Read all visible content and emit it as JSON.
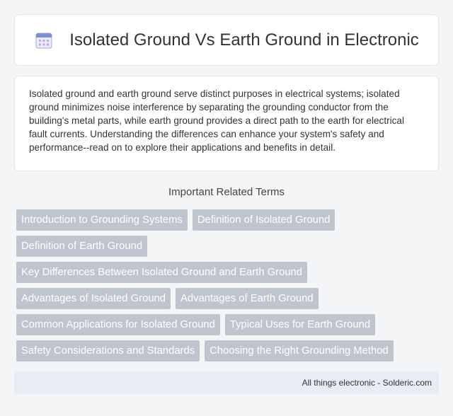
{
  "header": {
    "title": "Isolated Ground Vs Earth Ground in Electronic",
    "icon": "calendar-grid-icon"
  },
  "intro": {
    "text": "Isolated ground and earth ground serve distinct purposes in electrical systems; isolated ground minimizes noise interference by separating the grounding conductor from the building's metal parts, while earth ground provides a direct path to the earth for electrical fault currents. Understanding the differences can enhance your system's safety and performance--read on to explore their applications and benefits in detail."
  },
  "terms": {
    "heading": "Important Related Terms",
    "items": [
      "Introduction to Grounding Systems",
      "Definition of Isolated Ground",
      "Definition of Earth Ground",
      "Key Differences Between Isolated Ground and Earth Ground",
      "Advantages of Isolated Ground",
      "Advantages of Earth Ground",
      "Common Applications for Isolated Ground",
      "Typical Uses for Earth Ground",
      "Safety Considerations and Standards",
      "Choosing the Right Grounding Method"
    ]
  },
  "footer": {
    "text": "All things electronic - Solderic.com"
  },
  "colors": {
    "chip_bg": "#bfc5cd",
    "footer_bg": "#e7ecf5",
    "icon_accent": "#7a8fd6"
  }
}
